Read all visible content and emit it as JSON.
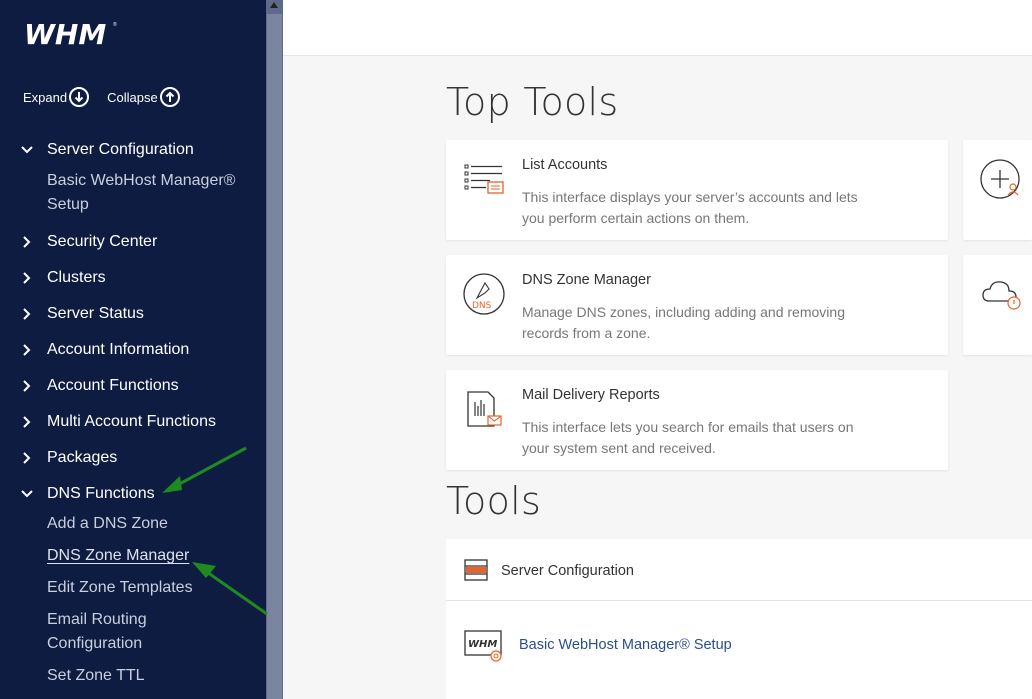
{
  "sidebar": {
    "logo_text": "WHM",
    "expand_label": "Expand",
    "collapse_label": "Collapse",
    "items": [
      {
        "label": "Server Configuration",
        "expanded": true
      },
      {
        "label": "Security Center"
      },
      {
        "label": "Clusters"
      },
      {
        "label": "Server Status"
      },
      {
        "label": "Account Information"
      },
      {
        "label": "Account Functions"
      },
      {
        "label": "Multi Account Functions"
      },
      {
        "label": "Packages"
      },
      {
        "label": "DNS Functions",
        "expanded": true
      }
    ],
    "server_config_sub": [
      "Basic WebHost Manager®",
      "Setup"
    ],
    "dns_sub": [
      "Add a DNS Zone",
      "DNS Zone Manager",
      "Edit Zone Templates",
      "Email Routing",
      "Configuration",
      "Set Zone TTL"
    ]
  },
  "main": {
    "top_tools_heading": "Top Tools",
    "tools_heading": "Tools",
    "cards": [
      {
        "title": "List Accounts",
        "desc": "This interface displays your server’s accounts and lets you perform certain actions on them."
      },
      {
        "title": "DNS Zone Manager",
        "desc": "Manage DNS zones, including adding and removing records from a zone.",
        "icon_text": "DNS"
      },
      {
        "title": "Mail Delivery Reports",
        "desc": "This interface lets you search for emails that users on your system sent and received."
      }
    ],
    "tools_group": "Server Configuration",
    "tools_link": "Basic WebHost Manager® Setup",
    "tools_link_icon_text": "WHM"
  },
  "colors": {
    "sidebar_bg": "#0e1c42",
    "accent_orange": "#e8632b",
    "annotation_green": "#1f8a1f",
    "link_blue": "#2a4e8a"
  }
}
